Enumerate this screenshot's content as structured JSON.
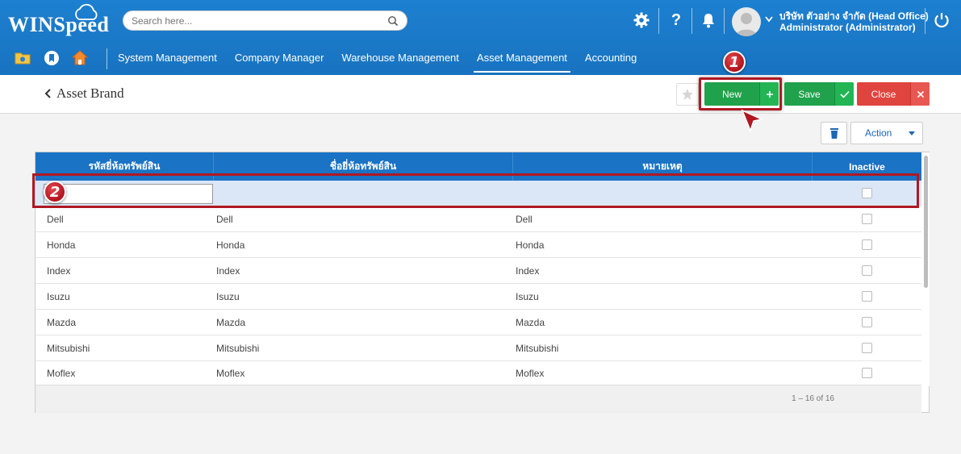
{
  "app": {
    "logo_text": "WINSpeed",
    "search_placeholder": "Search here...",
    "company": "บริษัท ตัวอย่าง จำกัด (Head Office)",
    "role": "Administrator (Administrator)",
    "icons": [
      "gear-icon",
      "help-icon",
      "bell-icon",
      "avatar",
      "power-icon",
      "folder-icon",
      "bookmark-icon",
      "home-icon"
    ]
  },
  "nav": {
    "items": [
      "System Management",
      "Company Manager",
      "Warehouse Management",
      "Asset Management",
      "Accounting"
    ],
    "active": "Asset Management"
  },
  "page": {
    "title": "Asset Brand",
    "buttons": {
      "new": "New",
      "save": "Save",
      "close": "Close",
      "action": "Action"
    }
  },
  "annotations": {
    "step1": "1",
    "step2": "2",
    "highlight_color": "#b01822"
  },
  "grid": {
    "columns": [
      "รหัสยี่ห้อทรัพย์สิน",
      "ชื่อยี่ห้อทรัพย์สิน",
      "หมายเหตุ",
      "Inactive"
    ],
    "rows": [
      {
        "code": "Dell",
        "name": "Dell",
        "note": "Dell"
      },
      {
        "code": "Honda",
        "name": "Honda",
        "note": "Honda"
      },
      {
        "code": "Index",
        "name": "Index",
        "note": "Index"
      },
      {
        "code": "Isuzu",
        "name": "Isuzu",
        "note": "Isuzu"
      },
      {
        "code": "Mazda",
        "name": "Mazda",
        "note": "Mazda"
      },
      {
        "code": "Mitsubishi",
        "name": "Mitsubishi",
        "note": "Mitsubishi"
      },
      {
        "code": "Moflex",
        "name": "Moflex",
        "note": "Moflex"
      }
    ],
    "pager": "1 – 16 of 16"
  },
  "colors": {
    "header": "#1a73c4",
    "new_green": "#1fa24b",
    "close_red": "#e0443e"
  }
}
